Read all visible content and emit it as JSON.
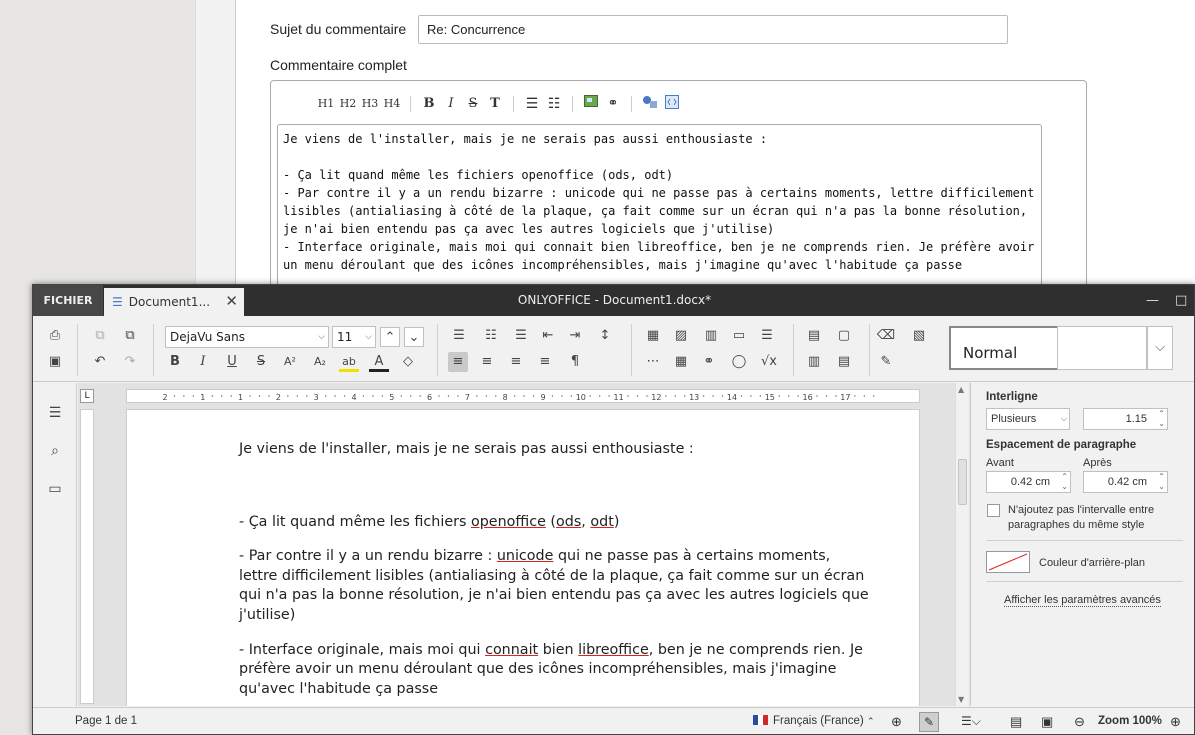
{
  "comment_form": {
    "subject_label": "Sujet du commentaire",
    "subject_value": "Re: Concurrence",
    "full_comment_label": "Commentaire complet",
    "toolbar": {
      "h1": "H1",
      "h2": "H2",
      "h3": "H3",
      "h4": "H4",
      "bold": "B",
      "italic": "I",
      "strike": "S",
      "tt": "T"
    },
    "text": "Je viens de l'installer, mais je ne serais pas aussi enthousiaste :\n\n- Ça lit quand même les fichiers openoffice (ods, odt)\n- Par contre il y a un rendu bizarre : unicode qui ne passe pas à certains moments, lettre difficilement lisibles (antialiasing à côté de la plaque, ça fait comme sur un écran qui n'a pas la bonne résolution, je n'ai bien entendu pas ça avec les autres logiciels que j'utilise)\n- Interface originale, mais moi qui connait bien libreoffice, ben je ne comprends rien. Je préfère avoir un menu déroulant que des icônes incompréhensibles, mais j'imagine qu'avec l'habitude ça passe"
  },
  "onlyoffice": {
    "file_tab": "FICHIER",
    "doc_tab": "Document1...",
    "doc_tab_close": "✕",
    "window_title": "ONLYOFFICE - Document1.docx*",
    "minimize": "—",
    "maximize": "□",
    "font_name": "DejaVu Sans",
    "font_size": "11",
    "style_normal": "Normal",
    "document": {
      "p1": "Je viens de l'installer, mais je ne serais pas aussi enthousiaste :",
      "p2a": "- Ça lit quand même les fichiers ",
      "p2b": "openoffice",
      "p2c": " (",
      "p2d": "ods",
      "p2e": ", ",
      "p2f": "odt",
      "p2g": ")",
      "p3a": "- Par contre il y a un rendu bizarre : ",
      "p3b": "unicode",
      "p3c": " qui ne passe pas à certains moments, lettre difficilement lisibles (antialiasing à côté de la plaque, ça fait comme sur un écran qui n'a pas la bonne résolution, je n'ai bien entendu pas ça avec les autres logiciels que j'utilise)",
      "p4a": "- Interface originale, mais moi qui ",
      "p4b": "connait",
      "p4c": " bien ",
      "p4d": "libreoffice",
      "p4e": ", ben je ne comprends rien. Je préfère avoir un menu déroulant que des icônes incompréhensibles, mais j'imagine qu'avec l'habitude ça passe"
    },
    "ruler_numbers": [
      "2",
      "1",
      "1",
      "2",
      "3",
      "4",
      "5",
      "6",
      "7",
      "8",
      "9",
      "10",
      "11",
      "12",
      "13",
      "14",
      "15",
      "16",
      "17"
    ],
    "panel": {
      "line_spacing_label": "Interligne",
      "line_spacing_mode": "Plusieurs",
      "line_spacing_value": "1.15",
      "para_spacing_label": "Espacement de paragraphe",
      "before_label": "Avant",
      "after_label": "Après",
      "before_value": "0.42 cm",
      "after_value": "0.42 cm",
      "no_interval_label": "N'ajoutez pas l'intervalle entre paragraphes du même style",
      "bg_color_label": "Couleur d'arrière-plan",
      "advanced_link": "Afficher les paramètres avancés"
    },
    "status": {
      "page": "Page 1 de 1",
      "language": "Français (France)",
      "zoom": "Zoom 100%"
    }
  }
}
